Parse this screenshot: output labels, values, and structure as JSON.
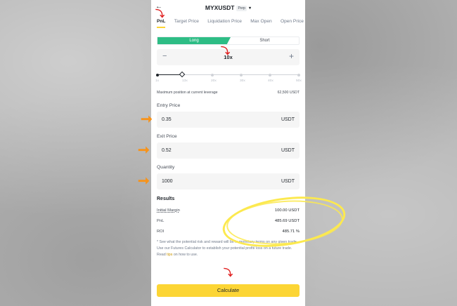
{
  "header": {
    "title": "MYXUSDT",
    "badge": "Perp"
  },
  "tabs": [
    {
      "label": "PnL"
    },
    {
      "label": "Target Price"
    },
    {
      "label": "Liquidation Price"
    },
    {
      "label": "Max Open"
    },
    {
      "label": "Open Price"
    }
  ],
  "toggle": {
    "long": "Long",
    "short": "Short"
  },
  "leverage": {
    "value": "10x",
    "minus": "−",
    "plus": "+"
  },
  "slider_ticks": [
    "1x",
    "13x",
    "20x",
    "30x",
    "40x",
    "50x"
  ],
  "max_position": {
    "label": "Maximum position at current leverage",
    "value": "62,500 USDT"
  },
  "entry": {
    "label": "Entry Price",
    "value": "0.35",
    "unit": "USDT"
  },
  "exit": {
    "label": "Exit Price",
    "value": "0.52",
    "unit": "USDT"
  },
  "quantity": {
    "label": "Quantity",
    "value": "1000",
    "unit": "USDT"
  },
  "results": {
    "title": "Results",
    "rows": [
      {
        "label": "Initial Margin",
        "value": "100.00 USDT"
      },
      {
        "label": "PnL",
        "value": "485.69 USDT"
      },
      {
        "label": "ROI",
        "value": "485.71 %"
      }
    ]
  },
  "note": {
    "text": "* See what the potential risk and reward will be in monetary terms on any given trade. Use our Futures Calculator to establish your potential profit/ loss on a future trade. Read ",
    "link": "tips",
    "suffix": " on how to use."
  },
  "calculate": "Calculate",
  "colors": {
    "accent": "#fcd535",
    "long": "#2ebd85",
    "annotation_arrow_red": "#e02020",
    "annotation_arrow_orange": "#f7931a",
    "annotation_ellipse": "#fce94f"
  }
}
